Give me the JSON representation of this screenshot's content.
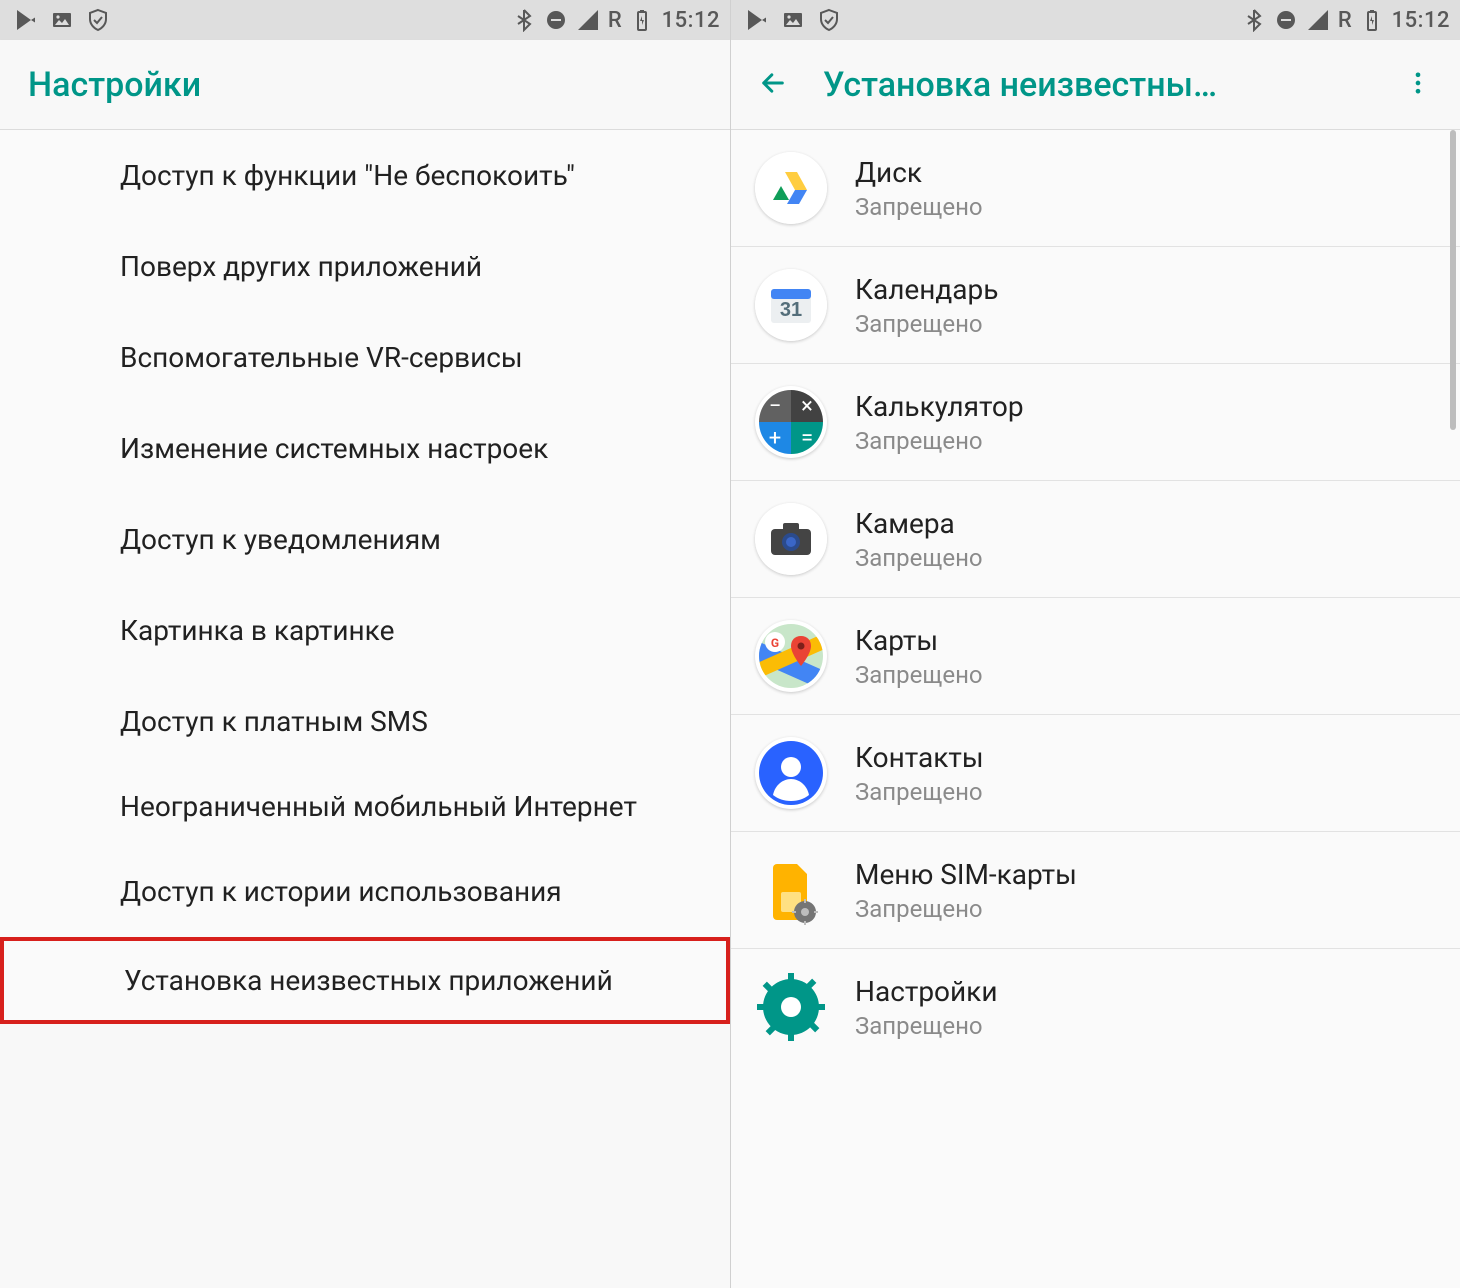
{
  "statusbar": {
    "network_label": "R",
    "time": "15:12"
  },
  "left": {
    "title": "Настройки",
    "items": [
      "Доступ к функции \"Не беспокоить\"",
      "Поверх других приложений",
      "Вспомогательные VR-сервисы",
      "Изменение системных настроек",
      "Доступ к уведомлениям",
      "Картинка в картинке",
      "Доступ к платным SMS",
      "Неограниченный мобильный Интернет",
      "Доступ к истории использования",
      "Установка неизвестных приложений"
    ]
  },
  "right": {
    "title": "Установка неизвестны…",
    "apps": [
      {
        "name": "Диск",
        "status": "Запрещено",
        "icon": "drive"
      },
      {
        "name": "Календарь",
        "status": "Запрещено",
        "icon": "calendar",
        "calendar_day": "31"
      },
      {
        "name": "Калькулятор",
        "status": "Запрещено",
        "icon": "calculator"
      },
      {
        "name": "Камера",
        "status": "Запрещено",
        "icon": "camera"
      },
      {
        "name": "Карты",
        "status": "Запрещено",
        "icon": "maps"
      },
      {
        "name": "Контакты",
        "status": "Запрещено",
        "icon": "contacts"
      },
      {
        "name": "Меню SIM-карты",
        "status": "Запрещено",
        "icon": "sim"
      },
      {
        "name": "Настройки",
        "status": "Запрещено",
        "icon": "settings"
      }
    ]
  }
}
